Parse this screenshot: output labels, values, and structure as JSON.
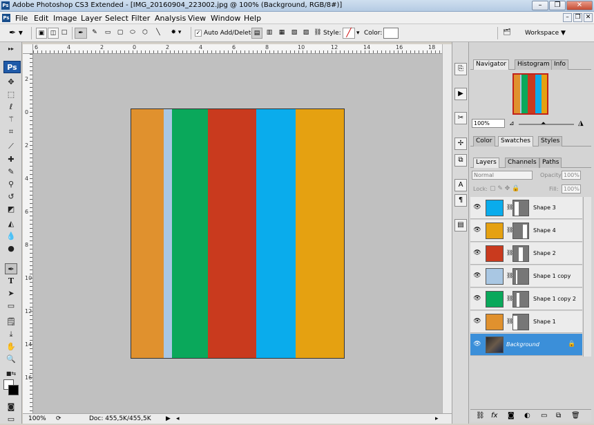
{
  "window": {
    "title": "Adobe Photoshop CS3 Extended - [IMG_20160904_223002.jpg @ 100% (Background, RGB/8#)]",
    "app_icon": "Ps",
    "minimize": "–",
    "restore": "❐",
    "close": "✕"
  },
  "menu": {
    "items": [
      "File",
      "Edit",
      "Image",
      "Layer",
      "Select",
      "Filter",
      "Analysis",
      "View",
      "Window",
      "Help"
    ],
    "doc_min": "–",
    "doc_restore": "❐",
    "doc_close": "✕"
  },
  "options": {
    "auto_add_delete": "Auto Add/Delete",
    "style_label": "Style:",
    "color_label": "Color:",
    "workspace": "Workspace ▼"
  },
  "ruler": {
    "h_labels": [
      "6",
      "4",
      "2",
      "0",
      "2",
      "4",
      "6",
      "8",
      "10",
      "12",
      "14",
      "16",
      "18"
    ],
    "v_labels": [
      "2",
      "0",
      "2",
      "4",
      "6",
      "8",
      "10",
      "12",
      "14",
      "16"
    ]
  },
  "colors": {
    "stripe_orange": "#e0912e",
    "stripe_lightblue": "#a9c7e3",
    "stripe_green": "#0aa85b",
    "stripe_red": "#c93a1e",
    "stripe_blue": "#0aacec",
    "stripe_gold": "#e5a111",
    "selection": "#3b8fd9"
  },
  "tools": [
    "move",
    "rect-marquee",
    "lasso",
    "magic-wand",
    "crop",
    "slice",
    "healing",
    "brush",
    "clone",
    "history",
    "eraser",
    "paint-bucket",
    "blur",
    "dodge",
    "pen",
    "type",
    "path-select",
    "shape",
    "notes",
    "eyedropper",
    "hand",
    "zoom"
  ],
  "panels": {
    "nav_tabs": [
      "Navigator",
      "Histogram",
      "Info"
    ],
    "nav_zoom": "100%",
    "color_tabs": [
      "Color",
      "Swatches",
      "Styles"
    ],
    "layer_tabs": [
      "Layers",
      "Channels",
      "Paths"
    ],
    "blend_mode": "Normal",
    "opacity_label": "Opacity:",
    "opacity": "100%",
    "lock_label": "Lock:",
    "fill_label": "Fill:",
    "fill": "100%"
  },
  "layers": [
    {
      "name": "Shape 3",
      "color": "#0aacec"
    },
    {
      "name": "Shape 4",
      "color": "#e5a111"
    },
    {
      "name": "Shape 2",
      "color": "#c93a1e"
    },
    {
      "name": "Shape 1 copy",
      "color": "#a9c7e3"
    },
    {
      "name": "Shape 1 copy 2",
      "color": "#0aa85b"
    },
    {
      "name": "Shape 1",
      "color": "#e0912e"
    },
    {
      "name": "Background",
      "color": "#444"
    }
  ],
  "status": {
    "zoom": "100%",
    "doc": "Doc: 455,5K/455,5K"
  }
}
